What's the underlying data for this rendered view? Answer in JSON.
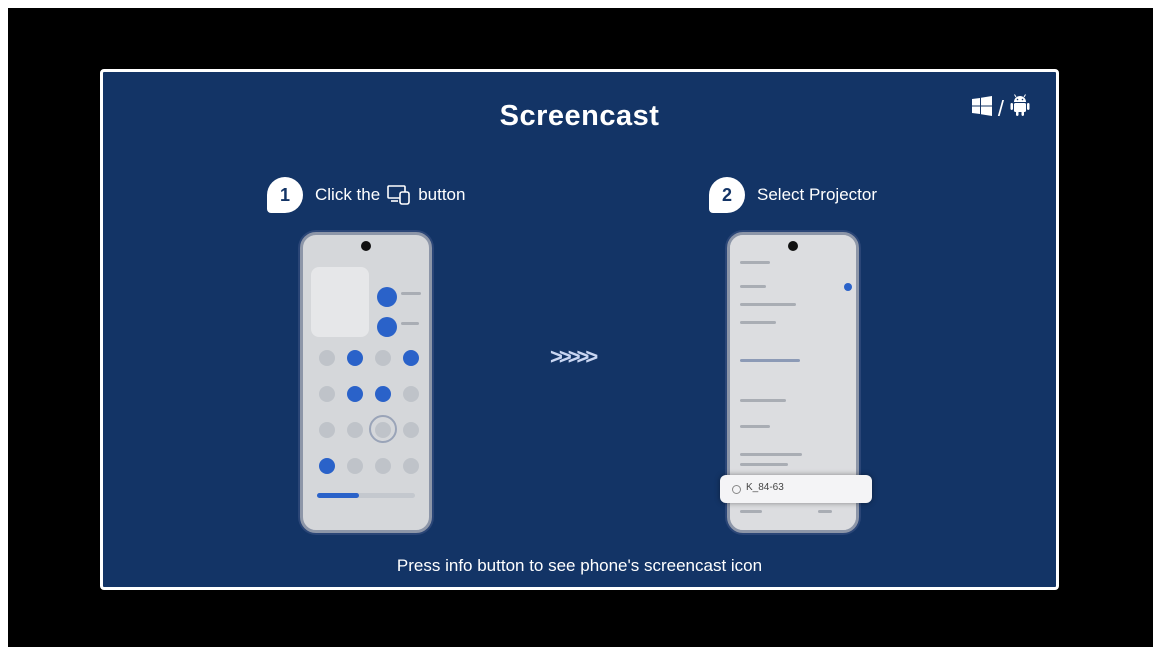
{
  "screen": {
    "title": "Screencast",
    "os_icons": [
      "windows-icon",
      "android-icon"
    ],
    "os_separator": "/"
  },
  "steps": [
    {
      "number": "1",
      "text_before": "Click the",
      "icon": "screencast-icon",
      "text_after": "button"
    },
    {
      "number": "2",
      "text_before": "Select Projector",
      "icon": "",
      "text_after": ""
    }
  ],
  "arrows": ">>>>>",
  "phone2": {
    "device_label": "K_84-63"
  },
  "footer": "Press info button to see phone's screencast icon",
  "colors": {
    "background": "#133466",
    "frame": "#000000",
    "border": "#ffffff",
    "accent": "#2a62c9"
  }
}
